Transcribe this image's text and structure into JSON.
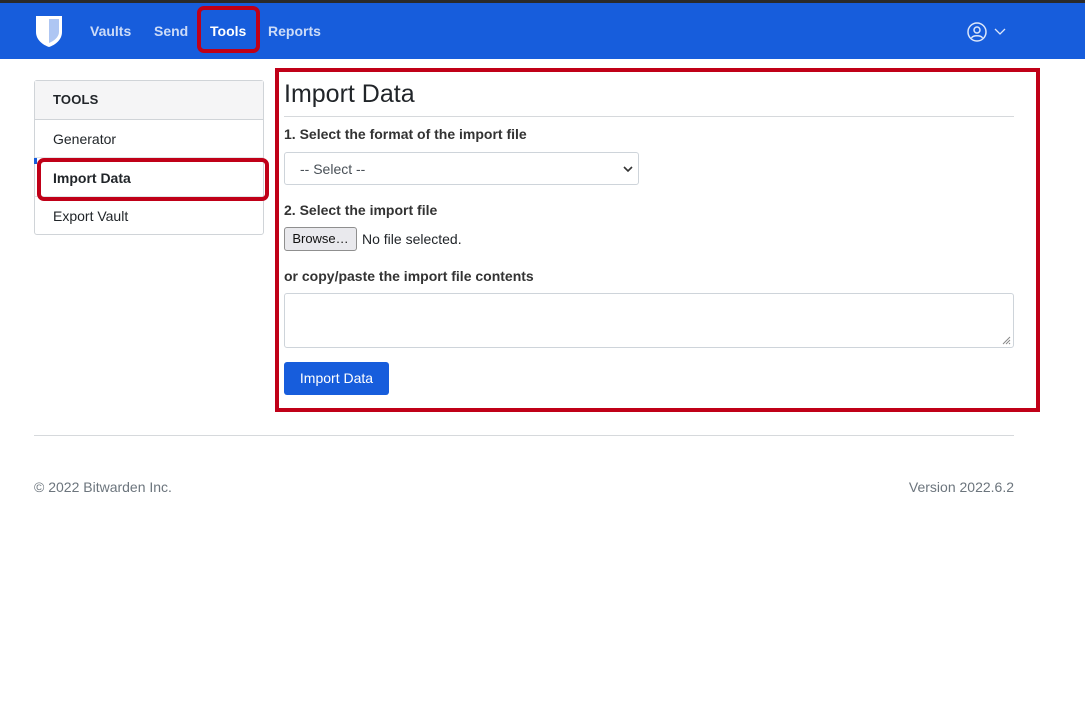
{
  "app": {
    "name": "Bitwarden"
  },
  "navbar": {
    "logo_icon": "bitwarden-shield-icon",
    "items": [
      {
        "label": "Vaults"
      },
      {
        "label": "Send"
      },
      {
        "label": "Tools",
        "active": true
      },
      {
        "label": "Reports"
      }
    ],
    "account_icon": "user-circle-icon",
    "dropdown_icon": "chevron-down-icon",
    "background_color": "#175ddc"
  },
  "sidebar": {
    "header": "TOOLS",
    "items": [
      {
        "label": "Generator"
      },
      {
        "label": "Import Data",
        "active": true
      },
      {
        "label": "Export Vault"
      }
    ]
  },
  "main": {
    "title": "Import Data",
    "format_label": "1. Select the format of the import file",
    "format_select": {
      "selected": "-- Select --"
    },
    "file_label": "2. Select the import file",
    "browse_label": "Browse…",
    "no_file_text": "No file selected.",
    "paste_label": "or copy/paste the import file contents",
    "paste_value": "",
    "submit_label": "Import Data"
  },
  "footer": {
    "copyright": "© 2022 Bitwarden Inc.",
    "version": "Version 2022.6.2"
  },
  "highlight_color": "#c00018"
}
